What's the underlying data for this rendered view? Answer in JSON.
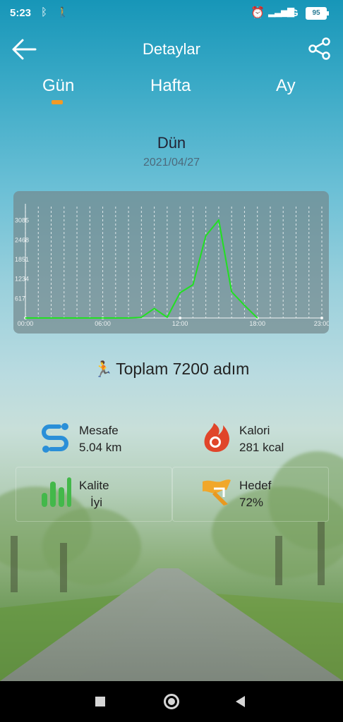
{
  "status_bar": {
    "time": "5:23",
    "network": "4G",
    "battery": "95",
    "icons": [
      "bluetooth-icon",
      "walking-icon",
      "alarm-icon",
      "signal-icon"
    ]
  },
  "header": {
    "title": "Detaylar",
    "icons": [
      "back-arrow-icon",
      "share-icon"
    ]
  },
  "tabs": {
    "items": [
      "Gün",
      "Hafta",
      "Ay"
    ],
    "selected": "Gün",
    "indicator_color": "#f39a25"
  },
  "date": {
    "title": "Dün",
    "subtitle": "2021/04/27"
  },
  "chart_data": {
    "type": "line",
    "x_ticks": [
      "00:00",
      "06:00",
      "12:00",
      "18:00",
      "23:00"
    ],
    "y_ticks": [
      "617",
      "1234",
      "1851",
      "2468",
      "3085"
    ],
    "ylim": [
      0,
      3300
    ],
    "xlim": [
      0,
      23
    ],
    "grid": true,
    "line_color": "#22e022",
    "x": [
      0,
      1,
      2,
      3,
      4,
      5,
      6,
      7,
      8,
      9,
      10,
      11,
      12,
      13,
      14,
      15,
      16,
      17,
      18
    ],
    "values": [
      0,
      0,
      0,
      0,
      0,
      0,
      0,
      0,
      0,
      20,
      300,
      20,
      800,
      1050,
      2600,
      3100,
      830,
      400,
      0
    ]
  },
  "summary": {
    "text": "Toplam 7200 adım",
    "icon": "walking-icon"
  },
  "stats": [
    {
      "label": "Mesafe",
      "value": "5.04 km",
      "icon": "distance-icon",
      "color": "#2a8fd8"
    },
    {
      "label": "Kalori",
      "value": "281 kcal",
      "icon": "flame-icon",
      "color": "#e0452a"
    },
    {
      "label": "Kalite",
      "value": "İyi",
      "icon": "bars-icon",
      "color": "#43b84a"
    },
    {
      "label": "Hedef",
      "value": "72%",
      "icon": "flag-icon",
      "color": "#f1a72a"
    }
  ],
  "nav": {
    "icons": [
      "recent-apps-icon",
      "home-icon",
      "nav-back-icon"
    ]
  }
}
